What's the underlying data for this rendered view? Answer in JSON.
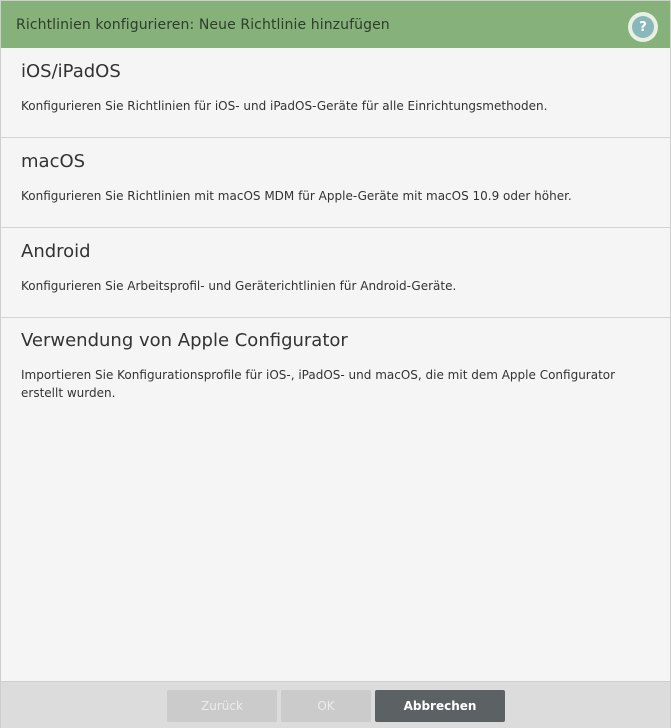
{
  "dialog": {
    "title": "Richtlinien konfigurieren: Neue Richtlinie hinzufügen",
    "help_glyph": "?",
    "help_icon": "question-circle-icon"
  },
  "options": [
    {
      "title": "iOS/iPadOS",
      "description": "Konfigurieren Sie Richtlinien für iOS- und iPadOS-Geräte für alle Einrichtungsmethoden."
    },
    {
      "title": "macOS",
      "description": "Konfigurieren Sie Richtlinien mit macOS MDM für Apple-Geräte mit macOS 10.9 oder höher."
    },
    {
      "title": "Android",
      "description": "Konfigurieren Sie Arbeitsprofil- und Geräterichtlinien für Android-Geräte."
    },
    {
      "title": "Verwendung von Apple Configurator",
      "description": "Importieren Sie Konfigurationsprofile für iOS-, iPadOS- und macOS, die mit dem Apple Configurator erstellt wurden."
    }
  ],
  "footer": {
    "back_label": "Zurück",
    "ok_label": "OK",
    "cancel_label": "Abbrechen"
  },
  "colors": {
    "titlebar": "#86b17a",
    "help_icon": "#8ab7ba",
    "primary_button": "#5c6163",
    "disabled_button": "#cbcbcb"
  }
}
